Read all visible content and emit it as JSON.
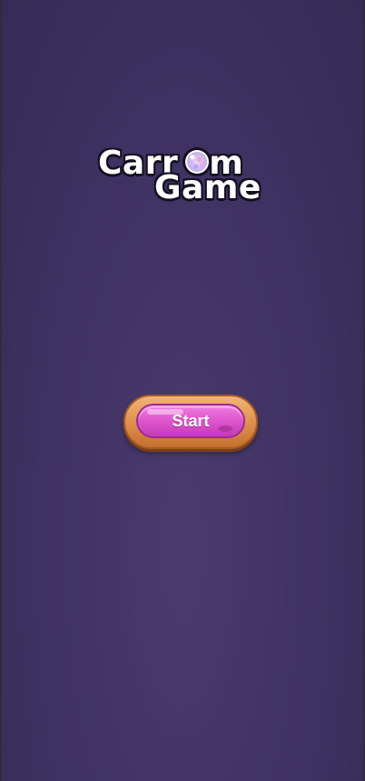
{
  "game": {
    "title_line1_left": "Carr",
    "title_line1_right": "m",
    "title_line2": "Game",
    "logo_coin_icon": "carrom-coin-icon"
  },
  "menu": {
    "start_label": "Start"
  },
  "colors": {
    "background": "#3e3262",
    "button_pink": "#df55cd",
    "button_frame_orange": "#e39550",
    "title_text": "#ffffff",
    "title_outline": "#141020"
  }
}
